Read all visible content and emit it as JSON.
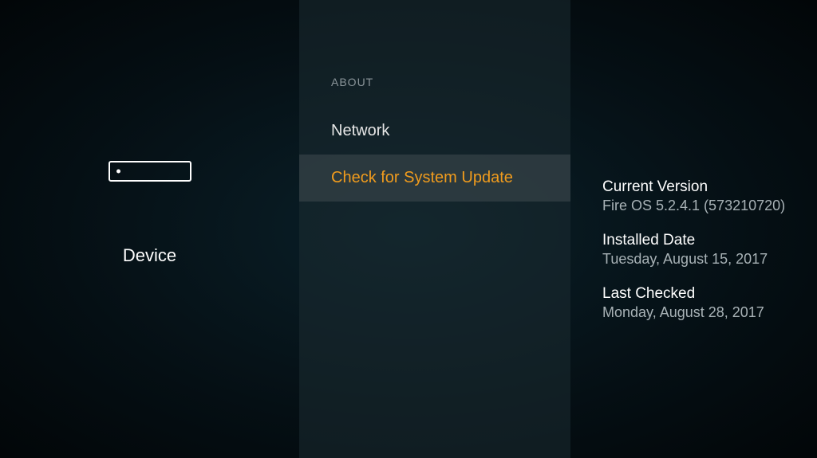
{
  "left": {
    "label": "Device"
  },
  "middle": {
    "header": "ABOUT",
    "items": [
      {
        "label": "Network"
      },
      {
        "label": "Check for System Update"
      }
    ]
  },
  "details": {
    "version_label": "Current Version",
    "version_value": "Fire OS 5.2.4.1 (573210720)",
    "installed_label": "Installed Date",
    "installed_value": "Tuesday, August 15, 2017",
    "checked_label": "Last Checked",
    "checked_value": "Monday, August 28, 2017"
  }
}
